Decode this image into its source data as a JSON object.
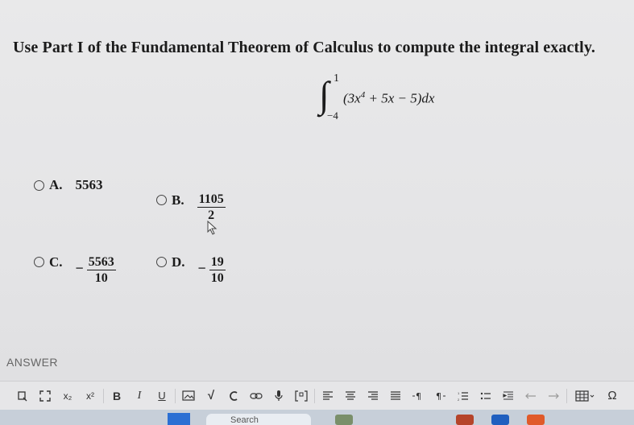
{
  "question": {
    "text": "Use Part I of the Fundamental Theorem of Calculus to compute the integral exactly."
  },
  "integral": {
    "sign": "∫",
    "upper": "1",
    "lower": "−4",
    "integrand_open": "(3x",
    "exp": "4",
    "integrand_rest": " + 5x − 5)dx"
  },
  "options": [
    {
      "letter": "A.",
      "value": "5563"
    },
    {
      "letter": "B.",
      "numerator": "1105",
      "denominator": "2"
    },
    {
      "letter": "C.",
      "sign": "−",
      "numerator": "5563",
      "denominator": "10"
    },
    {
      "letter": "D.",
      "sign": "−",
      "numerator": "19",
      "denominator": "10"
    }
  ],
  "answer_label": "ANSWER",
  "toolbar": {
    "subscript": "x₂",
    "superscript": "x²",
    "bold": "B",
    "italic": "I",
    "underline": "U",
    "sqrt": "√",
    "omega": "Ω"
  },
  "taskbar": {
    "search": "Search"
  }
}
